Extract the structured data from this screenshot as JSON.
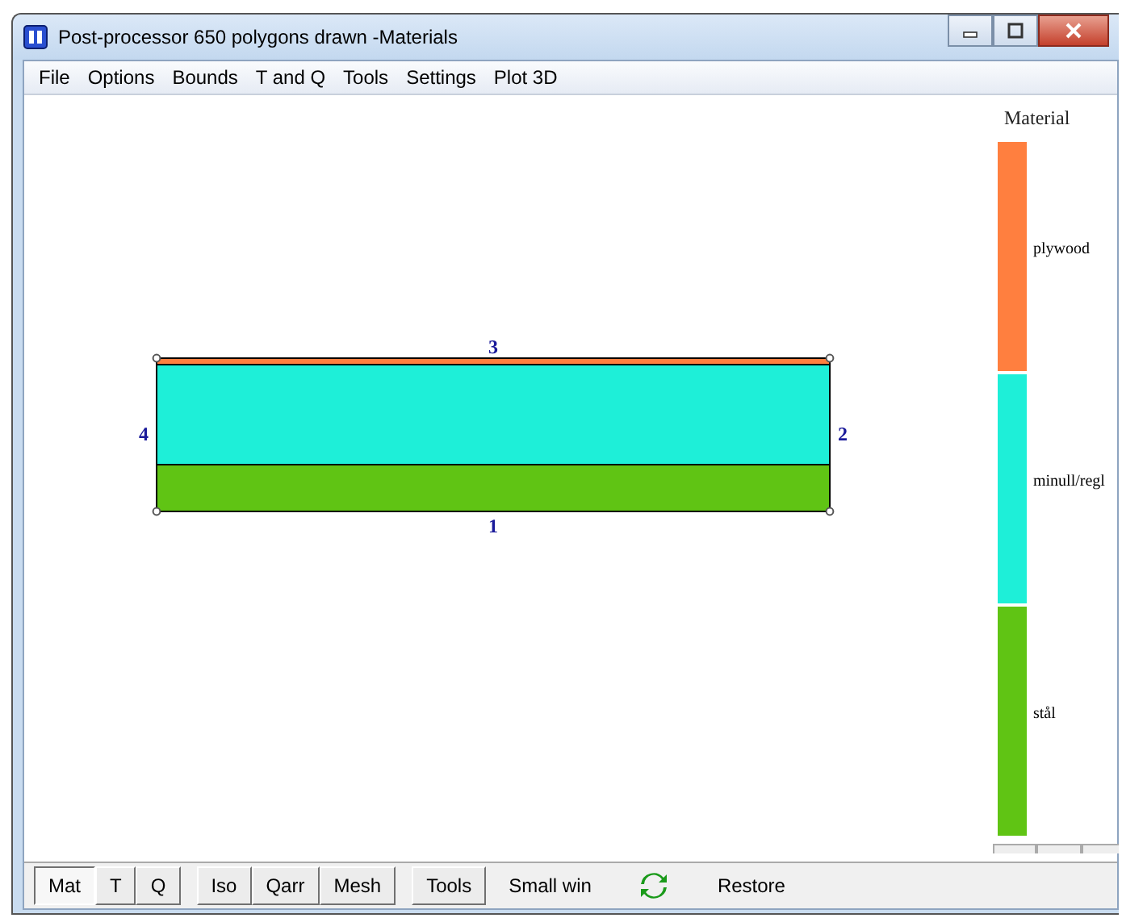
{
  "window": {
    "title": "Post-processor 650 polygons drawn -Materials"
  },
  "menu": [
    "File",
    "Options",
    "Bounds",
    "T and Q",
    "Tools",
    "Settings",
    "Plot 3D"
  ],
  "model": {
    "layers": [
      {
        "color": "#ff7f3f"
      },
      {
        "color": "#1eefd8"
      },
      {
        "color": "#60c414"
      }
    ],
    "edges": [
      {
        "label": "1"
      },
      {
        "label": "2"
      },
      {
        "label": "3"
      },
      {
        "label": "4"
      }
    ]
  },
  "legend": {
    "title": "Material",
    "items": [
      {
        "label": "plywood",
        "color": "#ff7f3f"
      },
      {
        "label": "minull/regl",
        "color": "#1eefd8"
      },
      {
        "label": "stål",
        "color": "#60c414"
      }
    ]
  },
  "toolbar": [
    {
      "kind": "toggle",
      "label": "Mat",
      "selected": true
    },
    {
      "kind": "toggle",
      "label": "T",
      "selected": false
    },
    {
      "kind": "toggle",
      "label": "Q",
      "selected": false
    },
    {
      "kind": "separator"
    },
    {
      "kind": "toggle",
      "label": "Iso",
      "selected": false
    },
    {
      "kind": "toggle",
      "label": "Qarr",
      "selected": false
    },
    {
      "kind": "toggle",
      "label": "Mesh",
      "selected": false
    },
    {
      "kind": "separator"
    },
    {
      "kind": "toggle",
      "label": "Tools",
      "selected": false
    },
    {
      "kind": "flat",
      "label": "Small win"
    },
    {
      "kind": "refresh"
    },
    {
      "kind": "flat",
      "label": "Restore"
    }
  ]
}
